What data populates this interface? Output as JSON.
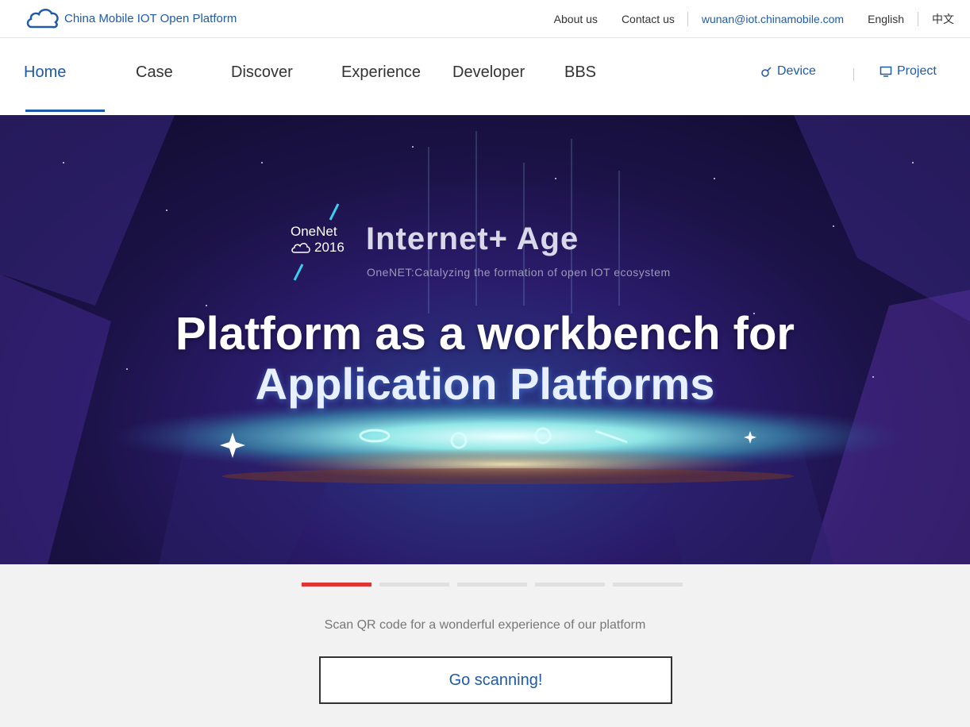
{
  "brand": {
    "name": "China Mobile IOT Open Platform",
    "logo_icon": "cloud-logo-icon"
  },
  "toplinks": {
    "about": "About us",
    "contact": "Contact us",
    "email": "wunan@iot.chinamobile.com",
    "english": "English",
    "chinese": "中文"
  },
  "nav": {
    "items": [
      {
        "label": "Home",
        "active": true
      },
      {
        "label": "Case"
      },
      {
        "label": "Discover"
      },
      {
        "label": "Experience"
      },
      {
        "label": "Developer"
      },
      {
        "label": "BBS"
      }
    ],
    "device": "Device",
    "project": "Project"
  },
  "hero": {
    "onenet": "OneNet",
    "year": "2016",
    "age_title": "Internet+ Age",
    "age_subtitle": "OneNET:Catalyzing the formation of open IOT ecosystem",
    "headline1": "Platform as a workbench for",
    "headline2": "Application Platforms"
  },
  "pager": {
    "count": 5,
    "active_index": 0
  },
  "scan": {
    "text": "Scan QR code for a wonderful experience of our platform",
    "button": "Go scanning!"
  },
  "colors": {
    "brand_blue": "#1f5aa6",
    "pager_active": "#e03535"
  }
}
